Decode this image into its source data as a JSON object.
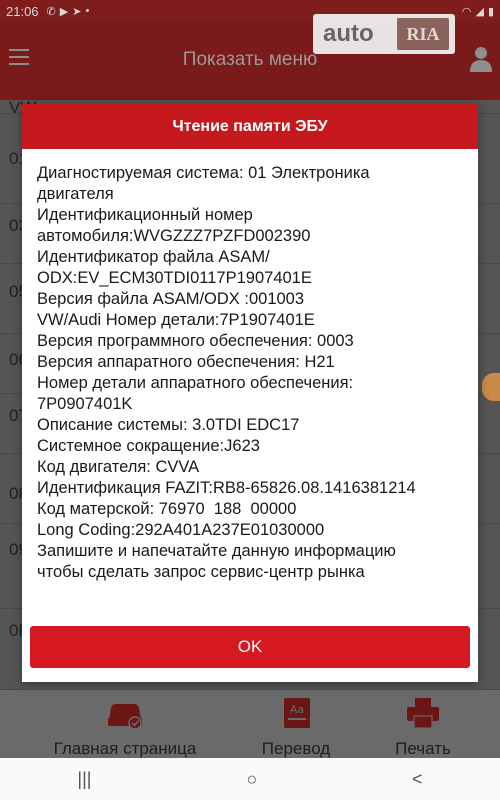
{
  "status_bar": {
    "time": "21:06",
    "icons_left": [
      "wifi-call-icon",
      "video-icon",
      "telegram-icon",
      "dot-icon"
    ],
    "icons_right": [
      "wifi-icon",
      "signal-icon",
      "battery-icon"
    ]
  },
  "app_bar": {
    "title": "Показать меню"
  },
  "watermark": {
    "part1": "auto",
    "part2": "RIA"
  },
  "background_rows": [
    "VW",
    "01",
    "03",
    "05",
    "06",
    "07",
    "08",
    "09",
    "0F"
  ],
  "dialog": {
    "title": "Чтение памяти ЭБУ",
    "lines": [
      "Диагностируемая система: 01 Электроника",
      "двигателя",
      "Идентификационный номер",
      "автомобиля:WVGZZZ7PZFD002390",
      "Идентификатор файла ASAM/",
      "ODX:EV_ECM30TDI0117P1907401E",
      "Версия файла ASAM/ODX :001003",
      "VW/Audi Номер детали:7P1907401E",
      "Версия программного обеспечения: 0003",
      "Версия аппаратного обеспечения: H21",
      "Номер детали аппаратного обеспечения:",
      "7P0907401K",
      "Описание системы: 3.0TDI EDC17",
      "Системное сокращение:J623",
      "Код двигателя: CVVA",
      "Идентификация FAZIT:RB8-65826.08.1416381214",
      "Код матерской: 76970  188  00000",
      "Long Coding:292A401A237E01030000",
      "Запишите и напечатайте данную информацию",
      "чтобы сделать запрос сервис-центр рынка"
    ],
    "ok_label": "OK"
  },
  "bottom_bar": {
    "home_label": "Главная страница",
    "translate_label": "Перевод",
    "print_label": "Печать"
  },
  "nav_bar": {
    "recents": "|||",
    "home": "○",
    "back": "<"
  },
  "colors": {
    "accent": "#d61921",
    "header": "#c5191e",
    "appbar": "#7a1a1a"
  }
}
